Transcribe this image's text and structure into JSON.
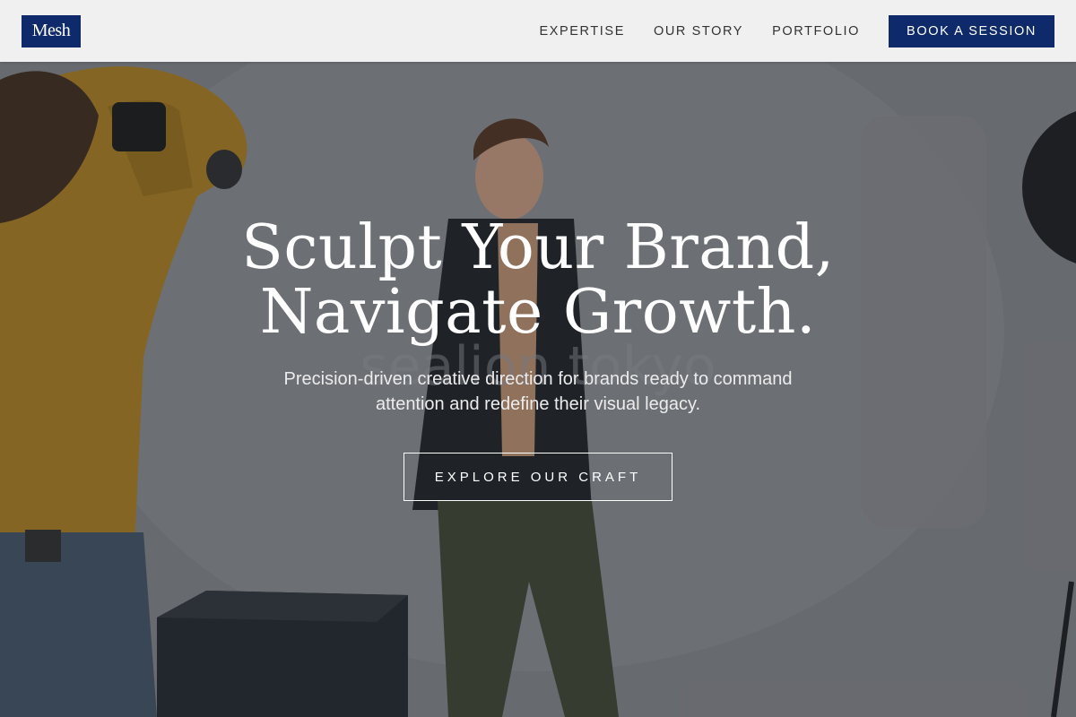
{
  "header": {
    "logo": "Mesh",
    "nav": [
      {
        "label": "EXPERTISE"
      },
      {
        "label": "OUR STORY"
      },
      {
        "label": "PORTFOLIO"
      }
    ],
    "cta_label": "BOOK A SESSION"
  },
  "hero": {
    "title_line1": "Sculpt Your Brand,",
    "title_line2": "Navigate Growth.",
    "subtitle_line1": "Precision-driven creative direction for brands ready to command",
    "subtitle_line2": "attention and redefine their visual legacy.",
    "button_label": "EXPLORE OUR CRAFT"
  },
  "colors": {
    "brand": "#0f2a6b",
    "header_bg": "#f0f0f0"
  }
}
